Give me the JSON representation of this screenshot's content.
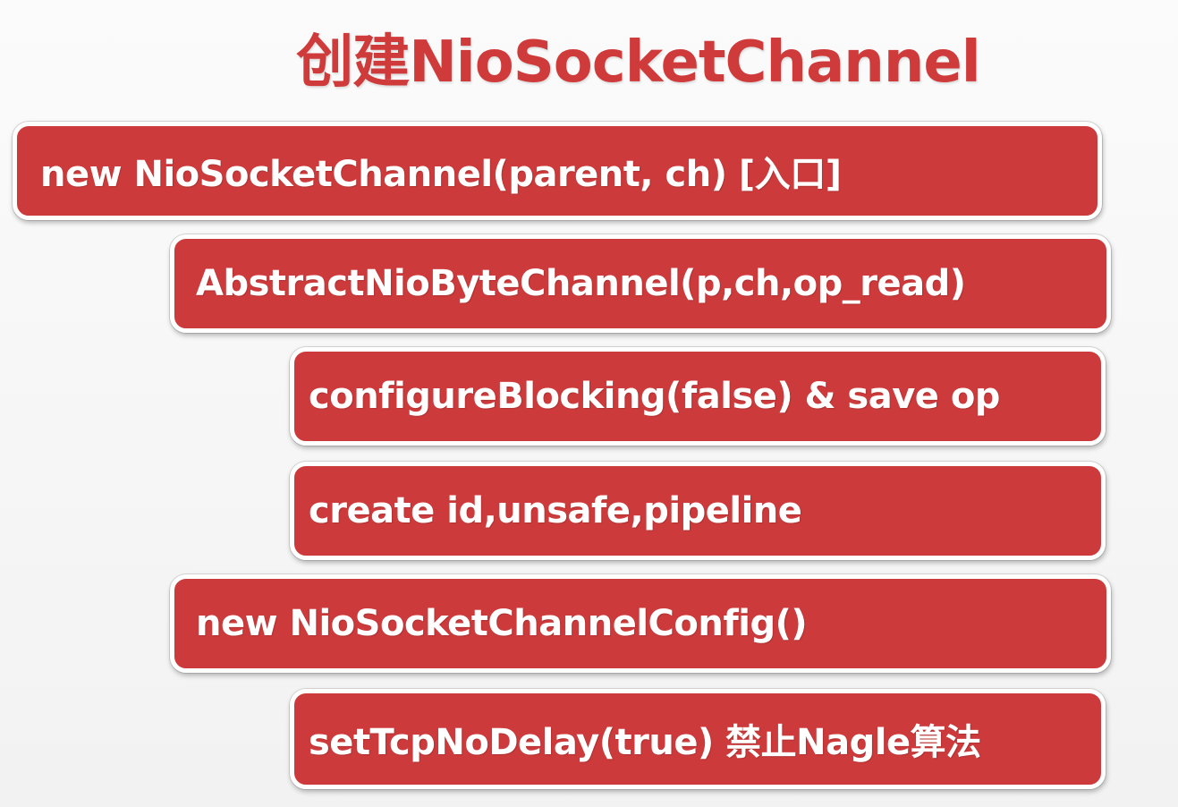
{
  "title": "创建NioSocketChannel",
  "steps": [
    {
      "label": "new NioSocketChannel(parent, ch) [入口]",
      "level": 0
    },
    {
      "label": "AbstractNioByteChannel(p,ch,op_read)",
      "level": 1
    },
    {
      "label": "configureBlocking(false) & save op",
      "level": 2
    },
    {
      "label": "create id,unsafe,pipeline",
      "level": 2
    },
    {
      "label": "new NioSocketChannelConfig()",
      "level": 1
    },
    {
      "label": "setTcpNoDelay(true) 禁止Nagle算法",
      "level": 2
    }
  ],
  "colors": {
    "accent": "#cd3a3b",
    "title": "#cf3a3a",
    "background": "#f7f7f7",
    "box_text": "#ffffff"
  }
}
